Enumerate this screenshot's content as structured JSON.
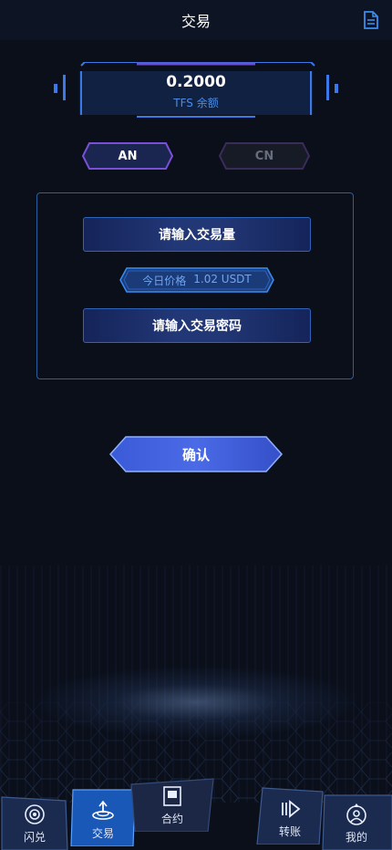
{
  "header": {
    "title": "交易",
    "doc_icon": "document-icon"
  },
  "balance": {
    "amount": "0.2000",
    "label": "TFS 余额"
  },
  "toggles": [
    {
      "label": "AN",
      "active": true
    },
    {
      "label": "CN",
      "active": false
    }
  ],
  "form": {
    "amount_placeholder": "请输入交易量",
    "price_label": "今日价格",
    "price_value": "1.02 USDT",
    "password_placeholder": "请输入交易密码"
  },
  "confirm_label": "确认",
  "nav": [
    {
      "label": "闪兑",
      "icon": "target-icon",
      "active": false
    },
    {
      "label": "交易",
      "icon": "exchange-icon",
      "active": true
    },
    {
      "label": "合约",
      "icon": "contract-icon",
      "active": false
    },
    {
      "label": "转账",
      "icon": "transfer-icon",
      "active": false
    },
    {
      "label": "我的",
      "icon": "profile-icon",
      "active": false
    }
  ],
  "colors": {
    "background": "#0a0f1a",
    "accent": "#3b78e8",
    "active_toggle": "#7a4fd8",
    "label_blue": "#4a8de8"
  }
}
